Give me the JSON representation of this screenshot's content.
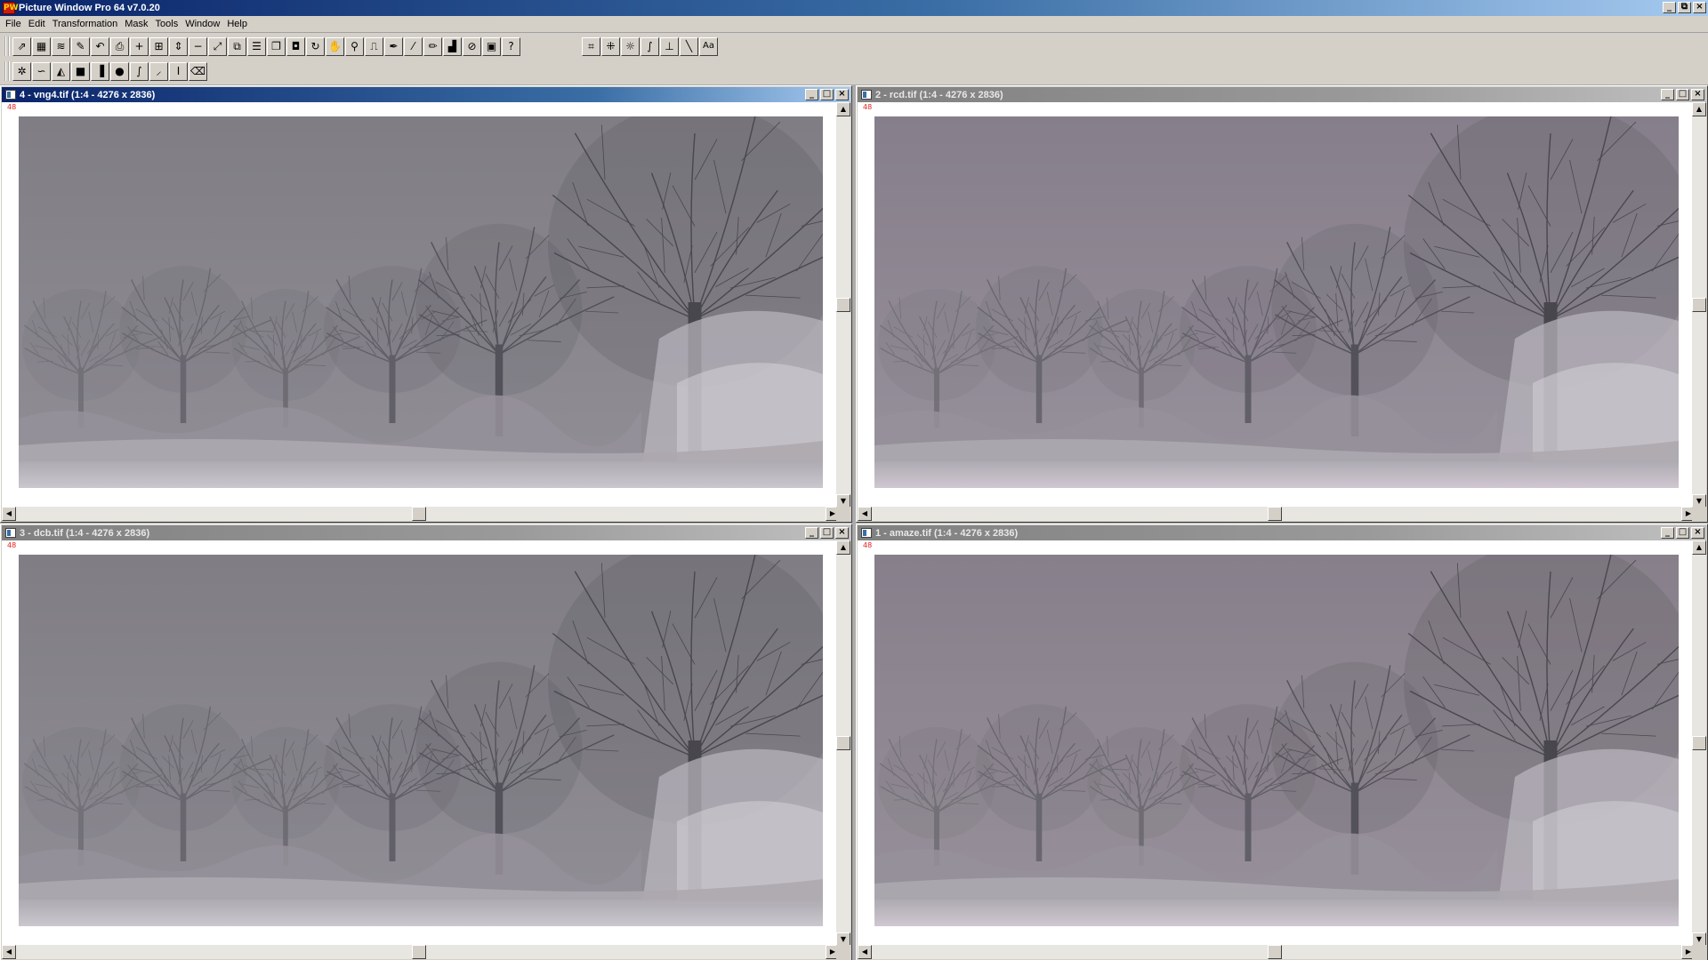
{
  "app": {
    "title": "Picture Window Pro 64  v7.0.20",
    "icon_letters": "PW"
  },
  "menu": [
    {
      "label": "File"
    },
    {
      "label": "Edit"
    },
    {
      "label": "Transformation"
    },
    {
      "label": "Mask"
    },
    {
      "label": "Tools"
    },
    {
      "label": "Window"
    },
    {
      "label": "Help"
    }
  ],
  "toolbar_row1": [
    {
      "name": "open-icon",
      "glyph": "⇗"
    },
    {
      "name": "grid-icon",
      "glyph": "▦"
    },
    {
      "name": "waves-icon",
      "glyph": "≋"
    },
    {
      "name": "edit-icon",
      "glyph": "✎"
    },
    {
      "name": "undo-icon",
      "glyph": "↶"
    },
    {
      "name": "print-icon",
      "glyph": "⎙"
    },
    {
      "name": "add-icon",
      "glyph": "+"
    },
    {
      "name": "zoom-fit-icon",
      "glyph": "⊞"
    },
    {
      "name": "resize-icon",
      "glyph": "⇕"
    },
    {
      "name": "remove-icon",
      "glyph": "−"
    },
    {
      "name": "full-screen-icon",
      "glyph": "⤢"
    },
    {
      "name": "duplicate-icon",
      "glyph": "⧉"
    },
    {
      "name": "list-icon",
      "glyph": "☰"
    },
    {
      "name": "windows-icon",
      "glyph": "❐"
    },
    {
      "name": "camera-icon",
      "glyph": "◘"
    },
    {
      "name": "rotate-icon",
      "glyph": "↻"
    },
    {
      "name": "hand-icon",
      "glyph": "✋"
    },
    {
      "name": "magnifier-icon",
      "glyph": "⚲"
    },
    {
      "name": "stamp-icon",
      "glyph": "⎍"
    },
    {
      "name": "pen-icon",
      "glyph": "✒"
    },
    {
      "name": "brush-icon",
      "glyph": "⁄"
    },
    {
      "name": "pencil-icon",
      "glyph": "✏"
    },
    {
      "name": "histogram-icon",
      "glyph": "▟"
    },
    {
      "name": "paperclip-icon",
      "glyph": "⊘"
    },
    {
      "name": "screenshot-icon",
      "glyph": "▣"
    },
    {
      "name": "help-icon",
      "glyph": "?"
    }
  ],
  "toolbar_row1b": [
    {
      "name": "crop-icon",
      "glyph": "⌗"
    },
    {
      "name": "transform-icon",
      "glyph": "⁜"
    },
    {
      "name": "brightness-icon",
      "glyph": "☼"
    },
    {
      "name": "curves-icon",
      "glyph": "∫"
    },
    {
      "name": "levels-icon",
      "glyph": "⊥"
    },
    {
      "name": "line-icon",
      "glyph": "╲"
    },
    {
      "name": "text-icon",
      "glyph": "Aa"
    }
  ],
  "toolbar_row2": [
    {
      "name": "mask-brush-icon",
      "glyph": "✲"
    },
    {
      "name": "mask-curve-icon",
      "glyph": "∽"
    },
    {
      "name": "mask-shape-icon",
      "glyph": "◭"
    },
    {
      "name": "mask-fill-icon",
      "glyph": "■"
    },
    {
      "name": "mask-gradient-icon",
      "glyph": "▐"
    },
    {
      "name": "mask-sphere-icon",
      "glyph": "●"
    },
    {
      "name": "mask-curves-icon",
      "glyph": "∫"
    },
    {
      "name": "mask-dropper-icon",
      "glyph": "⸝"
    },
    {
      "name": "mask-text-icon",
      "glyph": "I"
    },
    {
      "name": "mask-eraser-icon",
      "glyph": "⌫"
    }
  ],
  "documents": [
    {
      "title": "4 - vng4.tif (1:4 - 4276 x 2836)",
      "zoom_tag": "48",
      "active": true,
      "sky": "#79767d",
      "sky2": "#8a8790",
      "ground": "#c7c4cb"
    },
    {
      "title": "2 - rcd.tif (1:4 - 4276 x 2836)",
      "zoom_tag": "48",
      "active": false,
      "sky": "#7f7884",
      "sky2": "#918a96",
      "ground": "#cdc4cf"
    },
    {
      "title": "3 - dcb.tif (1:4 - 4276 x 2836)",
      "zoom_tag": "48",
      "active": false,
      "sky": "#79767d",
      "sky2": "#8a8790",
      "ground": "#c7c4cb"
    },
    {
      "title": "1 - amaze.tif (1:4 - 4276 x 2836)",
      "zoom_tag": "48",
      "active": false,
      "sky": "#807883",
      "sky2": "#928a95",
      "ground": "#cdc4cf"
    }
  ],
  "window_buttons": {
    "minimize": "_",
    "maximize": "□",
    "close": "×"
  }
}
